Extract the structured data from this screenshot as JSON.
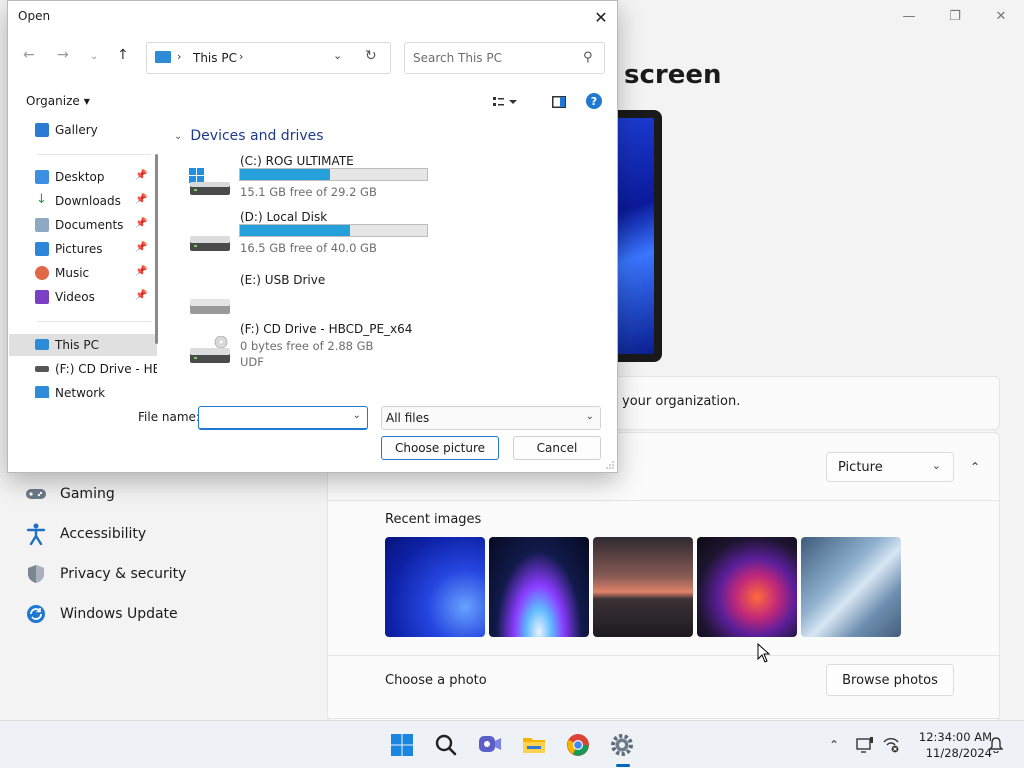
{
  "settings": {
    "page_title": "screen",
    "org_note": "your organization.",
    "background_type": "Picture",
    "recent_images_label": "Recent images",
    "choose_photo_label": "Choose a photo",
    "browse_photos_label": "Browse photos",
    "nav": [
      {
        "label": "Gaming",
        "icon": "gamepad-icon"
      },
      {
        "label": "Accessibility",
        "icon": "accessibility-icon"
      },
      {
        "label": "Privacy & security",
        "icon": "shield-icon"
      },
      {
        "label": "Windows Update",
        "icon": "update-icon"
      }
    ]
  },
  "dialog": {
    "title": "Open",
    "breadcrumb": "This PC",
    "search_placeholder": "Search This PC",
    "organize_label": "Organize",
    "nav_pane": [
      {
        "label": "Gallery",
        "icon": "gallery-icon",
        "pinned": false
      },
      {
        "label": "Desktop",
        "icon": "desktop-icon",
        "pinned": true
      },
      {
        "label": "Downloads",
        "icon": "downloads-icon",
        "pinned": true
      },
      {
        "label": "Documents",
        "icon": "documents-icon",
        "pinned": true
      },
      {
        "label": "Pictures",
        "icon": "pictures-icon",
        "pinned": true
      },
      {
        "label": "Music",
        "icon": "music-icon",
        "pinned": true
      },
      {
        "label": "Videos",
        "icon": "videos-icon",
        "pinned": true
      },
      {
        "label": "This PC",
        "icon": "this-pc-icon",
        "selected": true
      },
      {
        "label": "(F:) CD Drive - HB",
        "icon": "cd-drive-icon"
      },
      {
        "label": "Network",
        "icon": "network-icon"
      }
    ],
    "group_header": "Devices and drives",
    "drives": [
      {
        "name": "(C:) ROG ULTIMATE",
        "free_text": "15.1 GB free of 29.2 GB",
        "used_fraction": 0.48
      },
      {
        "name": "(D:) Local Disk",
        "free_text": "16.5 GB free of 40.0 GB",
        "used_fraction": 0.59
      },
      {
        "name": "(E:) USB Drive"
      },
      {
        "name": "(F:) CD Drive - HBCD_PE_x64",
        "free_text": "0 bytes free of 2.88 GB",
        "fs": "UDF"
      }
    ],
    "file_name_label": "File name:",
    "file_name_value": "",
    "file_type_filter": "All files",
    "choose_button": "Choose picture",
    "cancel_button": "Cancel"
  },
  "taskbar": {
    "time": "12:34:00 AM",
    "date": "11/28/2024"
  }
}
